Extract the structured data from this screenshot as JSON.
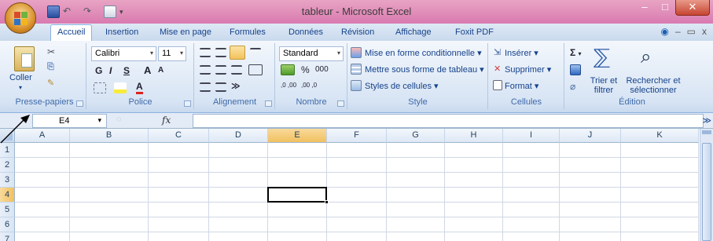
{
  "window": {
    "title": "tableur - Microsoft Excel",
    "minimize": "–",
    "maximize": "□",
    "close": "✕"
  },
  "tabs": [
    "Accueil",
    "Insertion",
    "Mise en page",
    "Formules",
    "Données",
    "Révision",
    "Affichage",
    "Foxit PDF"
  ],
  "active_tab": "Accueil",
  "ribbon": {
    "clipboard": {
      "paste_label": "Coller",
      "group_label": "Presse-papiers"
    },
    "font": {
      "font_name": "Calibri",
      "font_size": "11",
      "bold": "G",
      "italic": "I",
      "underline": "S",
      "grow": "A",
      "shrink": "A",
      "font_color": "A",
      "group_label": "Police"
    },
    "alignment": {
      "group_label": "Alignement"
    },
    "number": {
      "format": "Standard",
      "percent": "%",
      "thousands": "000",
      "inc_decimal": ",0 ,00",
      "dec_decimal": ",00 ,0",
      "group_label": "Nombre"
    },
    "style": {
      "conditional": "Mise en forme conditionnelle",
      "as_table": "Mettre sous forme de tableau",
      "cell_styles": "Styles de cellules",
      "group_label": "Style"
    },
    "cells": {
      "insert": "Insérer",
      "delete": "Supprimer",
      "format": "Format",
      "group_label": "Cellules"
    },
    "editing": {
      "sigma": "Σ",
      "sort_filter": "Trier et filtrer",
      "find_select": "Rechercher et sélectionner",
      "group_label": "Édition"
    }
  },
  "formula_bar": {
    "name_box": "E4",
    "fx": "fx",
    "formula": ""
  },
  "grid": {
    "columns": [
      "A",
      "B",
      "C",
      "D",
      "E",
      "F",
      "G",
      "H",
      "I",
      "J",
      "K"
    ],
    "rows": [
      "1",
      "2",
      "3",
      "4",
      "5",
      "6",
      "7"
    ],
    "selected_column": "E",
    "selected_row": "4"
  },
  "colors": {
    "title_bar": "#d97ab0",
    "selection_header": "#f1c15f",
    "ribbon": "#d7e4f4"
  }
}
